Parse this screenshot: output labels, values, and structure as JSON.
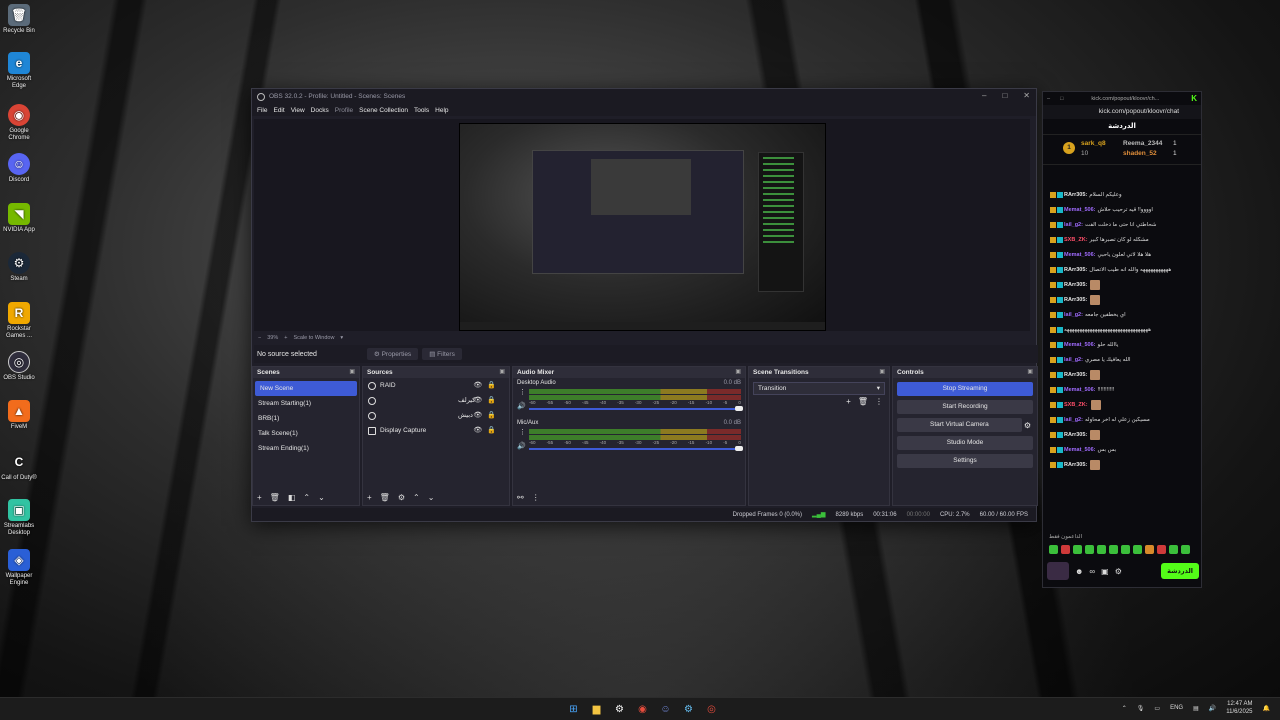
{
  "desktop": {
    "icons": [
      {
        "label": "Recycle Bin",
        "glyph": "🗑",
        "color": "#5b6b7a",
        "icon": "recycle-bin-icon"
      },
      {
        "label": "Microsoft Edge",
        "glyph": "e",
        "color": "#1f86d6",
        "icon": "edge-icon"
      },
      {
        "label": "Google Chrome",
        "glyph": "◉",
        "color": "#d94435",
        "icon": "chrome-icon"
      },
      {
        "label": "Discord",
        "glyph": "☺",
        "color": "#5865f2",
        "icon": "discord-icon"
      },
      {
        "label": "NVIDIA App",
        "glyph": "◥",
        "color": "#76b900",
        "icon": "nvidia-icon"
      },
      {
        "label": "Steam",
        "glyph": "⚙",
        "color": "#1b2838",
        "icon": "steam-icon"
      },
      {
        "label": "Rockstar Games ...",
        "glyph": "R",
        "color": "#f0a800",
        "icon": "rockstar-icon"
      },
      {
        "label": "OBS Studio",
        "glyph": "◎",
        "color": "#302e3d",
        "icon": "obs-icon"
      },
      {
        "label": "FiveM",
        "glyph": "▲",
        "color": "#f26c1c",
        "icon": "fivem-icon"
      },
      {
        "label": "Call of Duty®",
        "glyph": "C",
        "color": "#222222",
        "icon": "call-of-duty-icon"
      },
      {
        "label": "Streamlabs Desktop",
        "glyph": "▣",
        "color": "#31c3a2",
        "icon": "streamlabs-icon"
      },
      {
        "label": "Wallpaper Engine",
        "glyph": "◈",
        "color": "#2a5fd6",
        "icon": "wallpaper-engine-icon"
      }
    ]
  },
  "obs": {
    "title": "OBS 32.0.2 - Profile: Untitled - Scenes: Scenes",
    "menu": [
      "File",
      "Edit",
      "View",
      "Docks",
      "Profile",
      "Scene Collection",
      "Tools",
      "Help"
    ],
    "zoom": "39%",
    "zoom_label": "Scale to Window",
    "no_source": "No source selected",
    "properties": "Properties",
    "filters": "Filters",
    "scenes_title": "Scenes",
    "scenes": [
      "New Scene",
      "Stream Starting(1)",
      "BRB(1)",
      "Talk Scene(1)",
      "Stream Ending(1)"
    ],
    "sources_title": "Sources",
    "sources": [
      "RAID",
      "كيرلف",
      "دبيش",
      "Display Capture"
    ],
    "mixer_title": "Audio Mixer",
    "mixer": [
      {
        "name": "Desktop Audio",
        "db": "0.0 dB"
      },
      {
        "name": "Mic/Aux",
        "db": "0.0 dB"
      }
    ],
    "meter_ticks": [
      "-60",
      "-55",
      "-50",
      "-45",
      "-40",
      "-35",
      "-30",
      "-25",
      "-20",
      "-15",
      "-10",
      "-5",
      "0"
    ],
    "transitions_title": "Scene Transitions",
    "transition": "Transition",
    "controls_title": "Controls",
    "controls": [
      "Stop Streaming",
      "Start Recording",
      "Start Virtual Camera",
      "Studio Mode",
      "Settings"
    ],
    "status": {
      "dropped": "Dropped Frames 0 (0.0%)",
      "kbps": "8289 kbps",
      "stream_time": "00:31:06",
      "rec_time": "00:00:00",
      "cpu": "CPU: 2.7%",
      "fps": "60.00 / 60.00 FPS"
    }
  },
  "chat": {
    "url_short": "kick.com/popout/kloovr/ch...",
    "url": "kick.com/popout/kloovr/chat",
    "header": "الدردشة",
    "top_user1": "sark_q8",
    "top_user1_count": "10",
    "top_user2": "Reema_2344",
    "top_user2_count": "1",
    "top_user3": "shaden_52",
    "top_user3_count": "1",
    "messages": [
      {
        "name": "RArr305:",
        "type": "r",
        "text": "وعليكم السلام"
      },
      {
        "name": "Memat_506:",
        "type": "m",
        "text": "اوووو!! قيه ترحيب حلاش"
      },
      {
        "name": "lail_g2:",
        "type": "l",
        "text": "شحاطتي انا حتى ما دخلت الفت"
      },
      {
        "name": "SXB_ZK:",
        "type": "s",
        "text": "مشكله لو كان تصبرها كبير"
      },
      {
        "name": "Memat_506:",
        "type": "m",
        "text": "هلا هلا لاتي لعلون ياحبي"
      },
      {
        "name": "RArr305:",
        "type": "r",
        "text": "هههههههههههه والله انه طيب الاتصال"
      },
      {
        "name": "RArr305:",
        "type": "r",
        "text": ""
      },
      {
        "name": "RArr305:",
        "type": "r",
        "text": ""
      },
      {
        "name": "lail_g2:",
        "type": "l",
        "text": "اي يخطفين جامعه"
      },
      {
        "name": "",
        "type": "r",
        "text": "هههههههههههههههههههههههههههههههههه"
      },
      {
        "name": "Memat_506:",
        "type": "m",
        "text": "ياالله حلو"
      },
      {
        "name": "lail_g2:",
        "type": "l",
        "text": "الله يعافيك يا مصري"
      },
      {
        "name": "RArr305:",
        "type": "r",
        "text": ""
      },
      {
        "name": "Memat_506:",
        "type": "m",
        "text": "!!!!!!!!!!!"
      },
      {
        "name": "SXB_ZK:",
        "type": "s",
        "text": ""
      },
      {
        "name": "lail_g2:",
        "type": "l",
        "text": "مسيكين زعلي له اخر محاوله"
      },
      {
        "name": "RArr305:",
        "type": "r",
        "text": ""
      },
      {
        "name": "Memat_506:",
        "type": "m",
        "text": "بس بس"
      },
      {
        "name": "RArr305:",
        "type": "r",
        "text": ""
      }
    ],
    "supporters": "الداعمون فقط",
    "send": "الدردشة"
  },
  "taskbar": {
    "lang": "ENG",
    "time": "12:47 AM",
    "date": "11/6/2025"
  }
}
